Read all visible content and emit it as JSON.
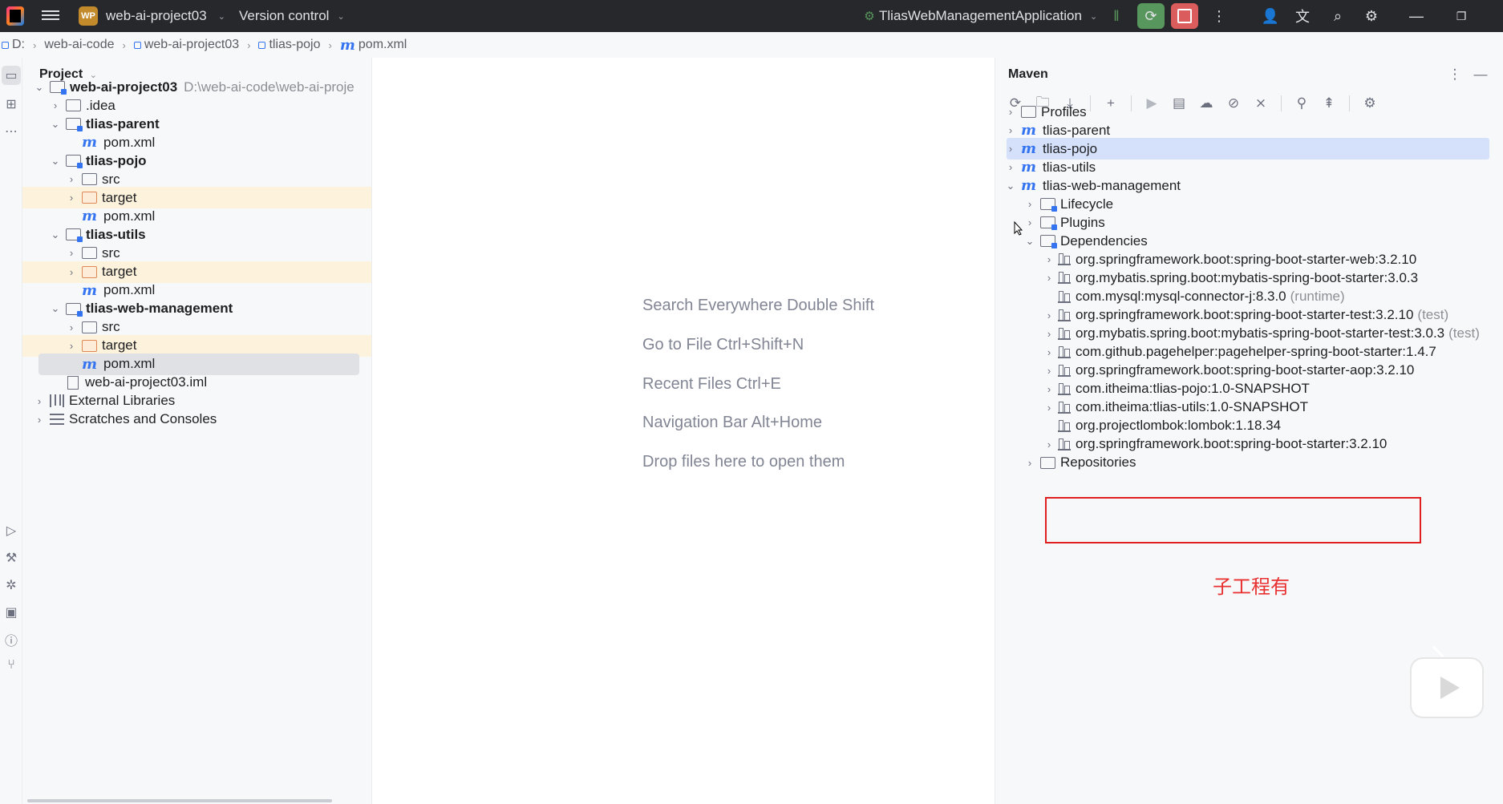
{
  "titlebar": {
    "project_badge": "WP",
    "project_name": "web-ai-project03",
    "version_control": "Version control",
    "run_config": "TliasWebManagementApplication"
  },
  "breadcrumb": [
    "D:",
    "web-ai-code",
    "web-ai-project03",
    "tlias-pojo",
    "pom.xml"
  ],
  "project_panel": {
    "title": "Project",
    "tree": [
      {
        "label": "web-ai-project03",
        "path": "D:\\web-ai-code\\web-ai-proje",
        "type": "module-folder",
        "arrow": "down",
        "indent": 0,
        "bold": true
      },
      {
        "label": ".idea",
        "type": "folder",
        "arrow": "right",
        "indent": 1
      },
      {
        "label": "tlias-parent",
        "type": "module-folder",
        "arrow": "down",
        "indent": 1,
        "bold": true
      },
      {
        "label": "pom.xml",
        "type": "maven",
        "indent": 2
      },
      {
        "label": "tlias-pojo",
        "type": "module-folder",
        "arrow": "down",
        "indent": 1,
        "bold": true
      },
      {
        "label": "src",
        "type": "folder",
        "arrow": "right",
        "indent": 2
      },
      {
        "label": "target",
        "type": "folder-orange",
        "arrow": "right",
        "indent": 2,
        "highlight": true
      },
      {
        "label": "pom.xml",
        "type": "maven",
        "indent": 2
      },
      {
        "label": "tlias-utils",
        "type": "module-folder",
        "arrow": "down",
        "indent": 1,
        "bold": true
      },
      {
        "label": "src",
        "type": "folder",
        "arrow": "right",
        "indent": 2
      },
      {
        "label": "target",
        "type": "folder-orange",
        "arrow": "right",
        "indent": 2,
        "highlight": true
      },
      {
        "label": "pom.xml",
        "type": "maven",
        "indent": 2
      },
      {
        "label": "tlias-web-management",
        "type": "module-folder",
        "arrow": "down",
        "indent": 1,
        "bold": true
      },
      {
        "label": "src",
        "type": "folder",
        "arrow": "right",
        "indent": 2
      },
      {
        "label": "target",
        "type": "folder-orange",
        "arrow": "right",
        "indent": 2,
        "highlight": true
      },
      {
        "label": "pom.xml",
        "type": "maven",
        "indent": 2,
        "selected": true
      },
      {
        "label": "web-ai-project03.iml",
        "type": "iml",
        "indent": 1
      },
      {
        "label": "External Libraries",
        "type": "library",
        "arrow": "right",
        "indent": 0
      },
      {
        "label": "Scratches and Consoles",
        "type": "scratch",
        "arrow": "right",
        "indent": 0
      }
    ]
  },
  "editor": {
    "hints": [
      "Search Everywhere Double Shift",
      "Go to File Ctrl+Shift+N",
      "Recent Files Ctrl+E",
      "Navigation Bar Alt+Home",
      "Drop files here to open them"
    ]
  },
  "maven_panel": {
    "title": "Maven",
    "tree": [
      {
        "label": "Profiles",
        "type": "folder",
        "arrow": "right",
        "indent": 0
      },
      {
        "label": "tlias-parent",
        "type": "maven",
        "arrow": "right",
        "indent": 0
      },
      {
        "label": "tlias-pojo",
        "type": "maven",
        "arrow": "right",
        "indent": 0,
        "selected": true
      },
      {
        "label": "tlias-utils",
        "type": "maven",
        "arrow": "right",
        "indent": 0
      },
      {
        "label": "tlias-web-management",
        "type": "maven",
        "arrow": "down",
        "indent": 0
      },
      {
        "label": "Lifecycle",
        "type": "gear-folder",
        "arrow": "right",
        "indent": 1
      },
      {
        "label": "Plugins",
        "type": "gear-folder",
        "arrow": "right",
        "indent": 1
      },
      {
        "label": "Dependencies",
        "type": "gear-folder",
        "arrow": "down",
        "indent": 1
      },
      {
        "label": "org.springframework.boot:spring-boot-starter-web:3.2.10",
        "type": "dep",
        "arrow": "right",
        "indent": 2
      },
      {
        "label": "org.mybatis.spring.boot:mybatis-spring-boot-starter:3.0.3",
        "type": "dep",
        "arrow": "right",
        "indent": 2
      },
      {
        "label": "com.mysql:mysql-connector-j:8.3.0",
        "scope": "(runtime)",
        "type": "dep",
        "indent": 2
      },
      {
        "label": "org.springframework.boot:spring-boot-starter-test:3.2.10",
        "scope": "(test)",
        "type": "dep",
        "arrow": "right",
        "indent": 2
      },
      {
        "label": "org.mybatis.spring.boot:mybatis-spring-boot-starter-test:3.0.3",
        "scope": "(test)",
        "type": "dep",
        "arrow": "right",
        "indent": 2
      },
      {
        "label": "com.github.pagehelper:pagehelper-spring-boot-starter:1.4.7",
        "type": "dep",
        "arrow": "right",
        "indent": 2
      },
      {
        "label": "org.springframework.boot:spring-boot-starter-aop:3.2.10",
        "type": "dep",
        "arrow": "right",
        "indent": 2
      },
      {
        "label": "com.itheima:tlias-pojo:1.0-SNAPSHOT",
        "type": "dep",
        "arrow": "right",
        "indent": 2
      },
      {
        "label": "com.itheima:tlias-utils:1.0-SNAPSHOT",
        "type": "dep",
        "arrow": "right",
        "indent": 2
      },
      {
        "label": "org.projectlombok:lombok:1.18.34",
        "type": "dep",
        "indent": 2
      },
      {
        "label": "org.springframework.boot:spring-boot-starter:3.2.10",
        "type": "dep",
        "arrow": "right",
        "indent": 2
      },
      {
        "label": "Repositories",
        "type": "folder",
        "arrow": "right",
        "indent": 1
      }
    ]
  },
  "annotation": {
    "note": "子工程有",
    "color": "#e83030"
  },
  "colors": {
    "accent": "#3574f0",
    "selection": "#d5e1fb",
    "highlight_target": "#fdf2dc"
  }
}
